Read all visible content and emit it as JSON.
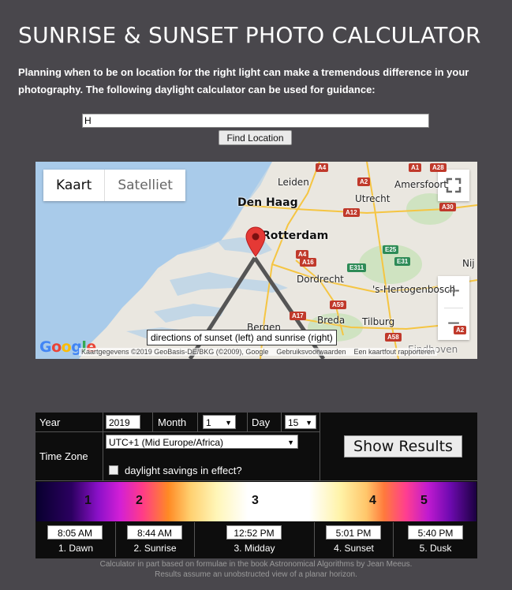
{
  "header": {
    "title": "SUNRISE & SUNSET PHOTO CALCULATOR",
    "intro": "Planning when to be on location for the right light can make a tremendous difference in your photography. The following daylight calculator can be used for guidance:"
  },
  "search": {
    "value": "H",
    "button_label": "Find Location"
  },
  "map": {
    "type_tabs": [
      "Kaart",
      "Satelliet"
    ],
    "cities": {
      "den_haag": "Den Haag",
      "rotterdam": "Rotterdam",
      "leiden": "Leiden",
      "utrecht": "Utrecht",
      "amersfoort": "Amersfoort",
      "dordrecht": "Dordrecht",
      "hertogenbosch": "'s-Hertogenbosch",
      "breda": "Breda",
      "tilburg": "Tilburg",
      "bergen": "Bergen",
      "nij": "Nij",
      "eindhoven": "Eindhoven"
    },
    "roads": [
      "A4",
      "A2",
      "A1",
      "A28",
      "A12",
      "A30",
      "A4",
      "A16",
      "E311",
      "E25",
      "E31",
      "A59",
      "A17",
      "A58",
      "A2"
    ],
    "tooltip": "directions of sunset (left) and sunrise (right)",
    "logo": "Google",
    "attribution": "Kaartgegevens ©2019 GeoBasis-DE/BKG (©2009), Google",
    "terms": "Gebruiksvoorwaarden",
    "report": "Een kaartfout rapporteren",
    "icons": {
      "fullscreen": "fullscreen-icon",
      "zoom_in": "+",
      "zoom_out": "−",
      "marker": "map-pin-icon"
    }
  },
  "calculator": {
    "year_label": "Year",
    "year_value": "2019",
    "month_label": "Month",
    "month_value": "1",
    "day_label": "Day",
    "day_value": "15",
    "tz_label": "Time Zone",
    "tz_value": "UTC+1 (Mid Europe/Africa)",
    "dst_label": "daylight savings in effect?",
    "dst_checked": false,
    "show_label": "Show Results"
  },
  "stages": [
    "1",
    "2",
    "3",
    "4",
    "5"
  ],
  "results": [
    {
      "time": "8:05 AM",
      "label": "1. Dawn"
    },
    {
      "time": "8:44 AM",
      "label": "2. Sunrise"
    },
    {
      "time": "12:52 PM",
      "label": "3. Midday"
    },
    {
      "time": "5:01 PM",
      "label": "4. Sunset"
    },
    {
      "time": "5:40 PM",
      "label": "5. Dusk"
    }
  ],
  "footnote": {
    "line1": "Calculator in part based on formulae in the book Astronomical Algorithms by Jean Meeus.",
    "line2": "Results assume an unobstructed view of a planar horizon."
  }
}
